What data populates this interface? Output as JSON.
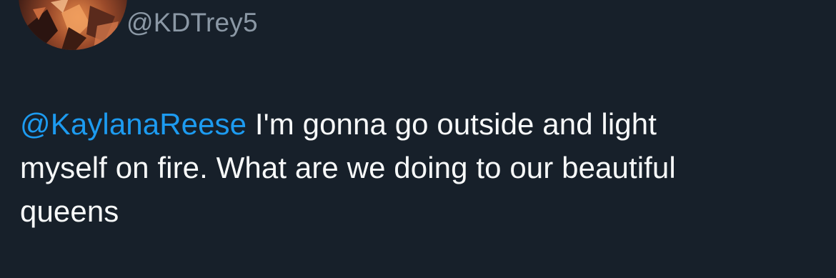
{
  "tweet": {
    "handle": "@KDTrey5",
    "mention": "@KaylanaReese",
    "text_lines": [
      " I'm gonna go outside and light",
      "myself on fire. What are we doing to our beautiful",
      "queens"
    ]
  },
  "colors": {
    "background": "#17202a",
    "text": "#f7f9f9",
    "secondary_text": "#8b98a5",
    "link": "#1d9bf0"
  },
  "icons": {
    "avatar": "profile-avatar",
    "verified": "verified-badge-icon",
    "affiliate": "affiliate-badge-icon"
  }
}
